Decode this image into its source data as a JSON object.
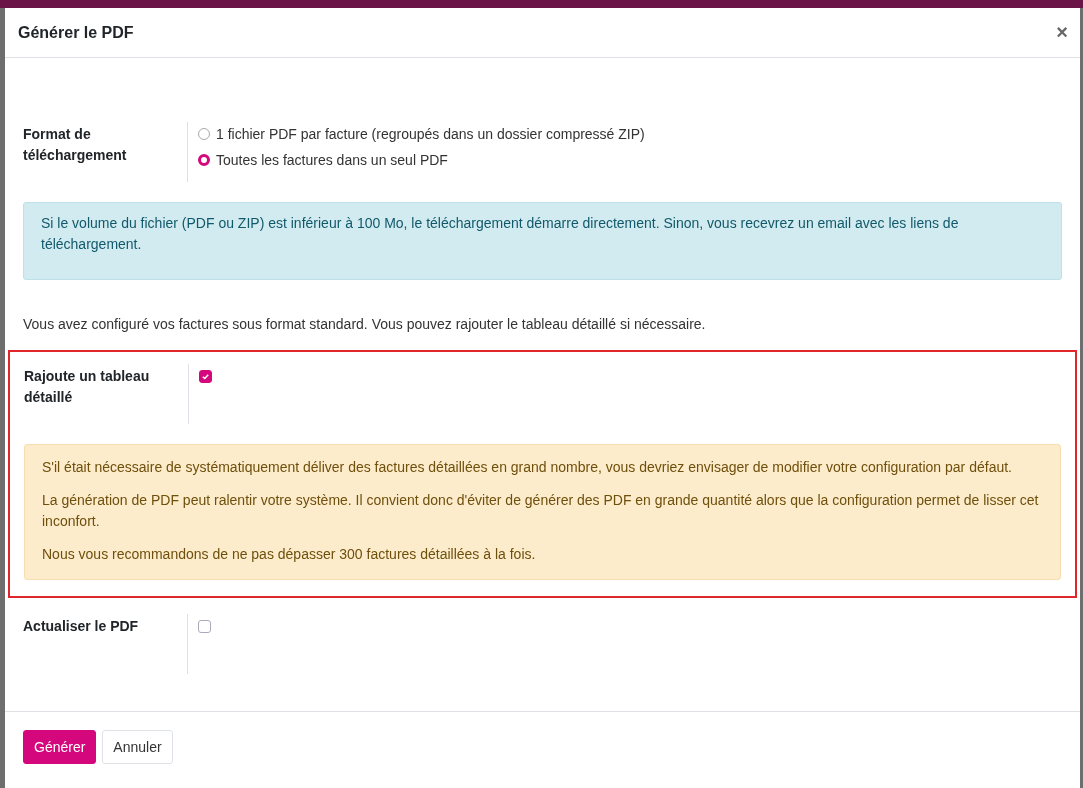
{
  "dialog": {
    "title": "Générer le PDF",
    "close": "×"
  },
  "format": {
    "label": "Format de téléchargement",
    "options": [
      {
        "label": "1 fichier PDF par facture (regroupés dans un dossier compressé ZIP)",
        "selected": false
      },
      {
        "label": "Toutes les factures dans un seul PDF",
        "selected": true
      }
    ]
  },
  "info_alert": "Si le volume du fichier (PDF ou ZIP) est inférieur à 100 Mo, le téléchargement démarre directement. Sinon, vous recevrez un email avec les liens de téléchargement.",
  "note": "Vous avez configuré vos factures sous format standard. Vous pouvez rajouter le tableau détaillé si nécessaire.",
  "detailed_table": {
    "label": "Rajoute un tableau détaillé",
    "checked": true,
    "highlighted": true,
    "warnings": [
      "S'il était nécessaire de systématiquement déliver des factures détaillées en grand nombre, vous devriez envisager de modifier votre configuration par défaut.",
      "La génération de PDF peut ralentir votre système. Il convient donc d'éviter de générer des PDF en grande quantité alors que la configuration permet de lisser cet inconfort.",
      "Nous vous recommandons de ne pas dépasser 300 factures détaillées à la fois."
    ]
  },
  "refresh_pdf": {
    "label": "Actualiser le PDF",
    "checked": false
  },
  "buttons": [
    {
      "label": "Générer",
      "kind": "primary"
    },
    {
      "label": "Annuler",
      "kind": "secondary"
    }
  ]
}
